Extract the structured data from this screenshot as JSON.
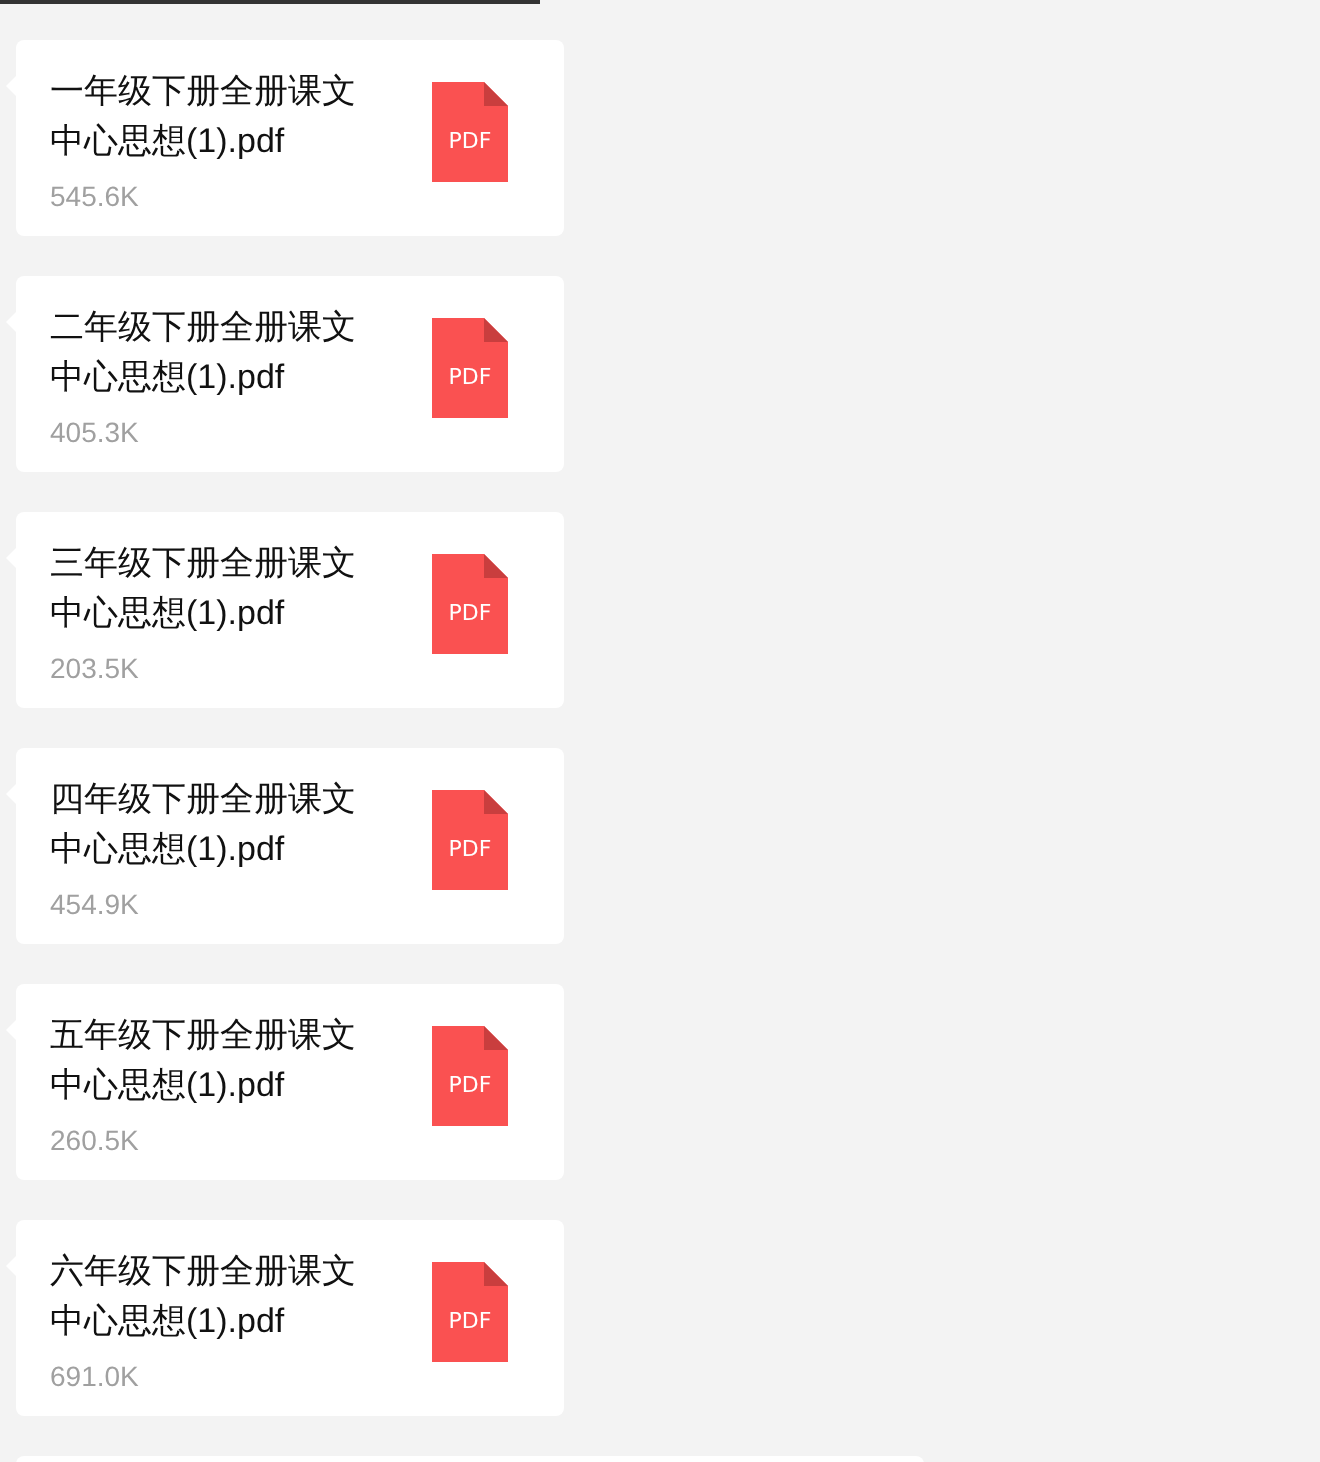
{
  "messages": [
    {
      "kind": "file",
      "title_line1": "一年级下册全册课文",
      "title_line2": "中心思想(1).pdf",
      "size": "545.6K",
      "icon_label": "PDF"
    },
    {
      "kind": "file",
      "title_line1": "二年级下册全册课文",
      "title_line2": "中心思想(1).pdf",
      "size": "405.3K",
      "icon_label": "PDF"
    },
    {
      "kind": "file",
      "title_line1": "三年级下册全册课文",
      "title_line2": "中心思想(1).pdf",
      "size": "203.5K",
      "icon_label": "PDF"
    },
    {
      "kind": "file",
      "title_line1": "四年级下册全册课文",
      "title_line2": "中心思想(1).pdf",
      "size": "454.9K",
      "icon_label": "PDF"
    },
    {
      "kind": "file",
      "title_line1": "五年级下册全册课文",
      "title_line2": "中心思想(1).pdf",
      "size": "260.5K",
      "icon_label": "PDF"
    },
    {
      "kind": "file",
      "title_line1": "六年级下册全册课文",
      "title_line2": "中心思想(1).pdf",
      "size": "691.0K",
      "icon_label": "PDF"
    },
    {
      "kind": "partial"
    }
  ]
}
